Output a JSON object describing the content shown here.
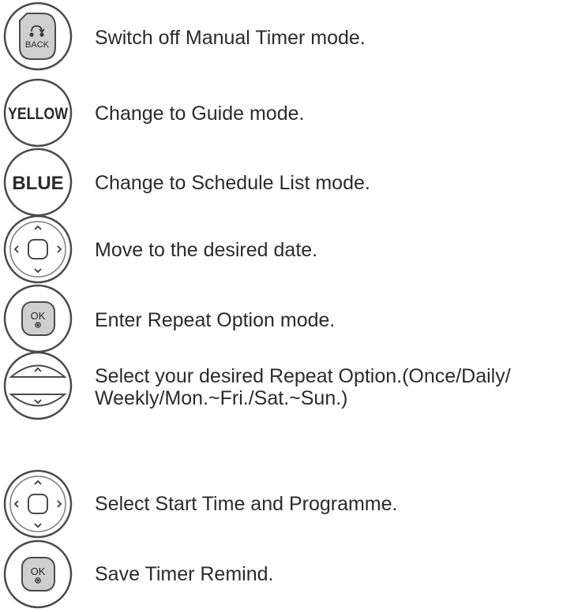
{
  "buttons": {
    "back": {
      "label": "BACK"
    },
    "yellow": {
      "label": "YELLOW"
    },
    "blue": {
      "label": "BLUE"
    },
    "ok": {
      "label": "OK"
    }
  },
  "steps": [
    {
      "text": "Switch off Manual Timer mode."
    },
    {
      "text": "Change to Guide mode."
    },
    {
      "text": "Change to Schedule List mode."
    },
    {
      "text": "Move to the desired date."
    },
    {
      "text": "Enter Repeat Option mode."
    },
    {
      "text": "Select your desired Repeat Option.(Once/Daily/",
      "text2": "Weekly/Mon.~Fri./Sat.~Sun.)"
    },
    {
      "text": "Select Start Time and Programme."
    },
    {
      "text": "Save Timer Remind."
    }
  ]
}
